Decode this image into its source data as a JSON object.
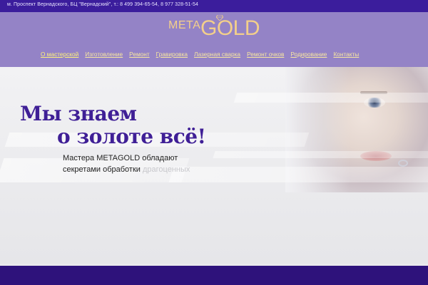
{
  "topbar": {
    "contact": "м. Проспект Вернадского, БЦ \"Вернадский\", т.: 8 499 394-65-54, 8 977 328-51-54"
  },
  "logo": {
    "meta": "META",
    "gold": "GOLD"
  },
  "nav": {
    "items": [
      "О мастерской",
      "Изготовление",
      "Ремонт",
      "Гравировка",
      "Лазерная сварка",
      "Ремонт очков",
      "Родирование",
      "Контакты"
    ]
  },
  "hero": {
    "headline_line1": "Мы знаем",
    "headline_line2": "о золоте всё!",
    "sub_line1": "Мастера METAGOLD обладают",
    "sub_line2": "секретами обработки",
    "sub_line2_faint": "драгоценных"
  },
  "colors": {
    "topbar": "#3b1d9c",
    "header": "#9483c6",
    "headline": "#3f1f96",
    "nav_link": "#f8e6a0",
    "logo_gold": "#f3cf8a",
    "footer": "#2e127b"
  }
}
